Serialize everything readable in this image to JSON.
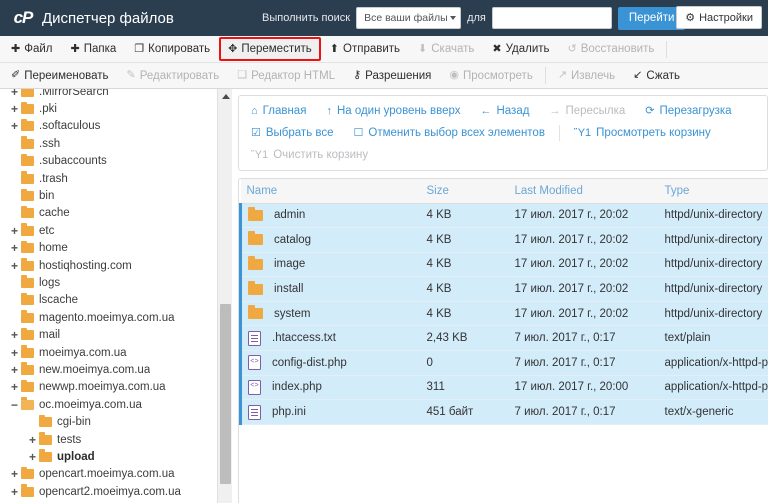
{
  "header": {
    "logo": "cp-logo-icon",
    "app_title": "Диспетчер файлов",
    "search_label": "Выполнить поиск",
    "search_scope_value": "Все ваши файлы",
    "search_scope_options": [
      "Все ваши файлы"
    ],
    "for_label": "для",
    "search_value": "",
    "search_placeholder": "",
    "go_label": "Перейти",
    "settings_label": "Настройки",
    "settings_icon": "gear-icon",
    "bg_color": "#2b3e50",
    "accent_color": "#3a93d4"
  },
  "toolbar": {
    "row1": [
      {
        "label": "Файл",
        "icon": "plus-icon",
        "disabled": false,
        "highlighted": false
      },
      {
        "label": "Папка",
        "icon": "plus-icon",
        "disabled": false,
        "highlighted": false
      },
      {
        "label": "Копировать",
        "icon": "copy-icon",
        "disabled": false,
        "highlighted": false
      },
      {
        "label": "Переместить",
        "icon": "move-arrows-icon",
        "disabled": false,
        "highlighted": true
      },
      {
        "label": "Отправить",
        "icon": "upload-icon",
        "disabled": false,
        "highlighted": false
      },
      {
        "label": "Скачать",
        "icon": "download-icon",
        "disabled": true,
        "highlighted": false
      },
      {
        "label": "Удалить",
        "icon": "x-icon",
        "disabled": false,
        "highlighted": false
      },
      {
        "label": "Восстановить",
        "icon": "undo-icon",
        "disabled": true,
        "highlighted": false
      }
    ],
    "row2": [
      {
        "label": "Переименовать",
        "icon": "rename-file-icon",
        "disabled": false
      },
      {
        "label": "Редактировать",
        "icon": "pencil-icon",
        "disabled": true
      },
      {
        "label": "Редактор HTML",
        "icon": "html-edit-icon",
        "disabled": true
      },
      {
        "label": "Разрешения",
        "icon": "key-icon",
        "disabled": false
      },
      {
        "label": "Просмотреть",
        "icon": "eye-icon",
        "disabled": true
      },
      {
        "label": "Извлечь",
        "icon": "extract-icon",
        "disabled": true
      },
      {
        "label": "Сжать",
        "icon": "compress-icon",
        "disabled": false
      }
    ],
    "highlight_color": "#ee1111"
  },
  "tree": {
    "items": [
      {
        "label": ".MirrorSearch",
        "toggle": "+",
        "indent": 0,
        "bold": false,
        "open": false
      },
      {
        "label": ".pki",
        "toggle": "+",
        "indent": 0,
        "bold": false,
        "open": false
      },
      {
        "label": ".softaculous",
        "toggle": "+",
        "indent": 0,
        "bold": false,
        "open": false
      },
      {
        "label": ".ssh",
        "toggle": "",
        "indent": 0,
        "bold": false,
        "open": false
      },
      {
        "label": ".subaccounts",
        "toggle": "",
        "indent": 0,
        "bold": false,
        "open": false
      },
      {
        "label": ".trash",
        "toggle": "",
        "indent": 0,
        "bold": false,
        "open": false
      },
      {
        "label": "bin",
        "toggle": "",
        "indent": 0,
        "bold": false,
        "open": false
      },
      {
        "label": "cache",
        "toggle": "",
        "indent": 0,
        "bold": false,
        "open": false
      },
      {
        "label": "etc",
        "toggle": "+",
        "indent": 0,
        "bold": false,
        "open": false
      },
      {
        "label": "home",
        "toggle": "+",
        "indent": 0,
        "bold": false,
        "open": false
      },
      {
        "label": "hostiqhosting.com",
        "toggle": "+",
        "indent": 0,
        "bold": false,
        "open": false
      },
      {
        "label": "logs",
        "toggle": "",
        "indent": 0,
        "bold": false,
        "open": false
      },
      {
        "label": "lscache",
        "toggle": "",
        "indent": 0,
        "bold": false,
        "open": false
      },
      {
        "label": "magento.moeimya.com.ua",
        "toggle": "",
        "indent": 0,
        "bold": false,
        "open": false
      },
      {
        "label": "mail",
        "toggle": "+",
        "indent": 0,
        "bold": false,
        "open": false
      },
      {
        "label": "moeimya.com.ua",
        "toggle": "+",
        "indent": 0,
        "bold": false,
        "open": false
      },
      {
        "label": "new.moeimya.com.ua",
        "toggle": "+",
        "indent": 0,
        "bold": false,
        "open": false
      },
      {
        "label": "newwp.moeimya.com.ua",
        "toggle": "+",
        "indent": 0,
        "bold": false,
        "open": false
      },
      {
        "label": "oc.moeimya.com.ua",
        "toggle": "−",
        "indent": 0,
        "bold": false,
        "open": true
      },
      {
        "label": "cgi-bin",
        "toggle": "",
        "indent": 1,
        "bold": false,
        "open": false
      },
      {
        "label": "tests",
        "toggle": "+",
        "indent": 1,
        "bold": false,
        "open": false
      },
      {
        "label": "upload",
        "toggle": "+",
        "indent": 1,
        "bold": true,
        "open": false
      },
      {
        "label": "opencart.moeimya.com.ua",
        "toggle": "+",
        "indent": 0,
        "bold": false,
        "open": false
      },
      {
        "label": "opencart2.moeimya.com.ua",
        "toggle": "+",
        "indent": 0,
        "bold": false,
        "open": false
      }
    ],
    "scrollbar": "vertical-scrollbar"
  },
  "nav": {
    "row1": [
      {
        "label": "Главная",
        "icon": "home-icon",
        "disabled": false
      },
      {
        "label": "На один уровень вверх",
        "icon": "up-arrow-icon",
        "disabled": false
      },
      {
        "label": "Назад",
        "icon": "back-arrow-icon",
        "disabled": false
      },
      {
        "label": "Пересылка",
        "icon": "forward-arrow-icon",
        "disabled": true
      },
      {
        "label": "Перезагрузка",
        "icon": "reload-icon",
        "disabled": false
      }
    ],
    "row2": [
      {
        "label": "Выбрать все",
        "icon": "checked-box-icon",
        "disabled": false
      },
      {
        "label": "Отменить выбор всех элементов",
        "icon": "unchecked-box-icon",
        "disabled": false
      },
      {
        "label": "Просмотреть корзину",
        "icon": "trash-icon",
        "disabled": false
      }
    ],
    "row3": [
      {
        "label": "Очистить корзину",
        "icon": "trash-icon",
        "disabled": true
      }
    ]
  },
  "file_table": {
    "columns": [
      "Name",
      "Size",
      "Last Modified",
      "Type"
    ],
    "rows": [
      {
        "name": "admin",
        "size": "4 KB",
        "modified": "17 июл. 2017 г., 20:02",
        "type": "httpd/unix-directory",
        "icon": "folder-icon",
        "selected": true
      },
      {
        "name": "catalog",
        "size": "4 KB",
        "modified": "17 июл. 2017 г., 20:02",
        "type": "httpd/unix-directory",
        "icon": "folder-icon",
        "selected": true
      },
      {
        "name": "image",
        "size": "4 KB",
        "modified": "17 июл. 2017 г., 20:02",
        "type": "httpd/unix-directory",
        "icon": "folder-icon",
        "selected": true
      },
      {
        "name": "install",
        "size": "4 KB",
        "modified": "17 июл. 2017 г., 20:02",
        "type": "httpd/unix-directory",
        "icon": "folder-icon",
        "selected": true
      },
      {
        "name": "system",
        "size": "4 KB",
        "modified": "17 июл. 2017 г., 20:02",
        "type": "httpd/unix-directory",
        "icon": "folder-icon",
        "selected": true
      },
      {
        "name": ".htaccess.txt",
        "size": "2,43 KB",
        "modified": "7 июл. 2017 г., 0:17",
        "type": "text/plain",
        "icon": "text-file-icon",
        "selected": true
      },
      {
        "name": "config-dist.php",
        "size": "0",
        "modified": "7 июл. 2017 г., 0:17",
        "type": "application/x-httpd-php",
        "icon": "php-file-icon",
        "selected": true
      },
      {
        "name": "index.php",
        "size": "311",
        "modified": "17 июл. 2017 г., 20:00",
        "type": "application/x-httpd-php",
        "icon": "php-file-icon",
        "selected": true
      },
      {
        "name": "php.ini",
        "size": "451 байт",
        "modified": "7 июл. 2017 г., 0:17",
        "type": "text/x-generic",
        "icon": "text-file-icon",
        "selected": true
      }
    ],
    "selected_row_bg": "#d3ecfa",
    "selected_row_border": "#3a93d4"
  }
}
